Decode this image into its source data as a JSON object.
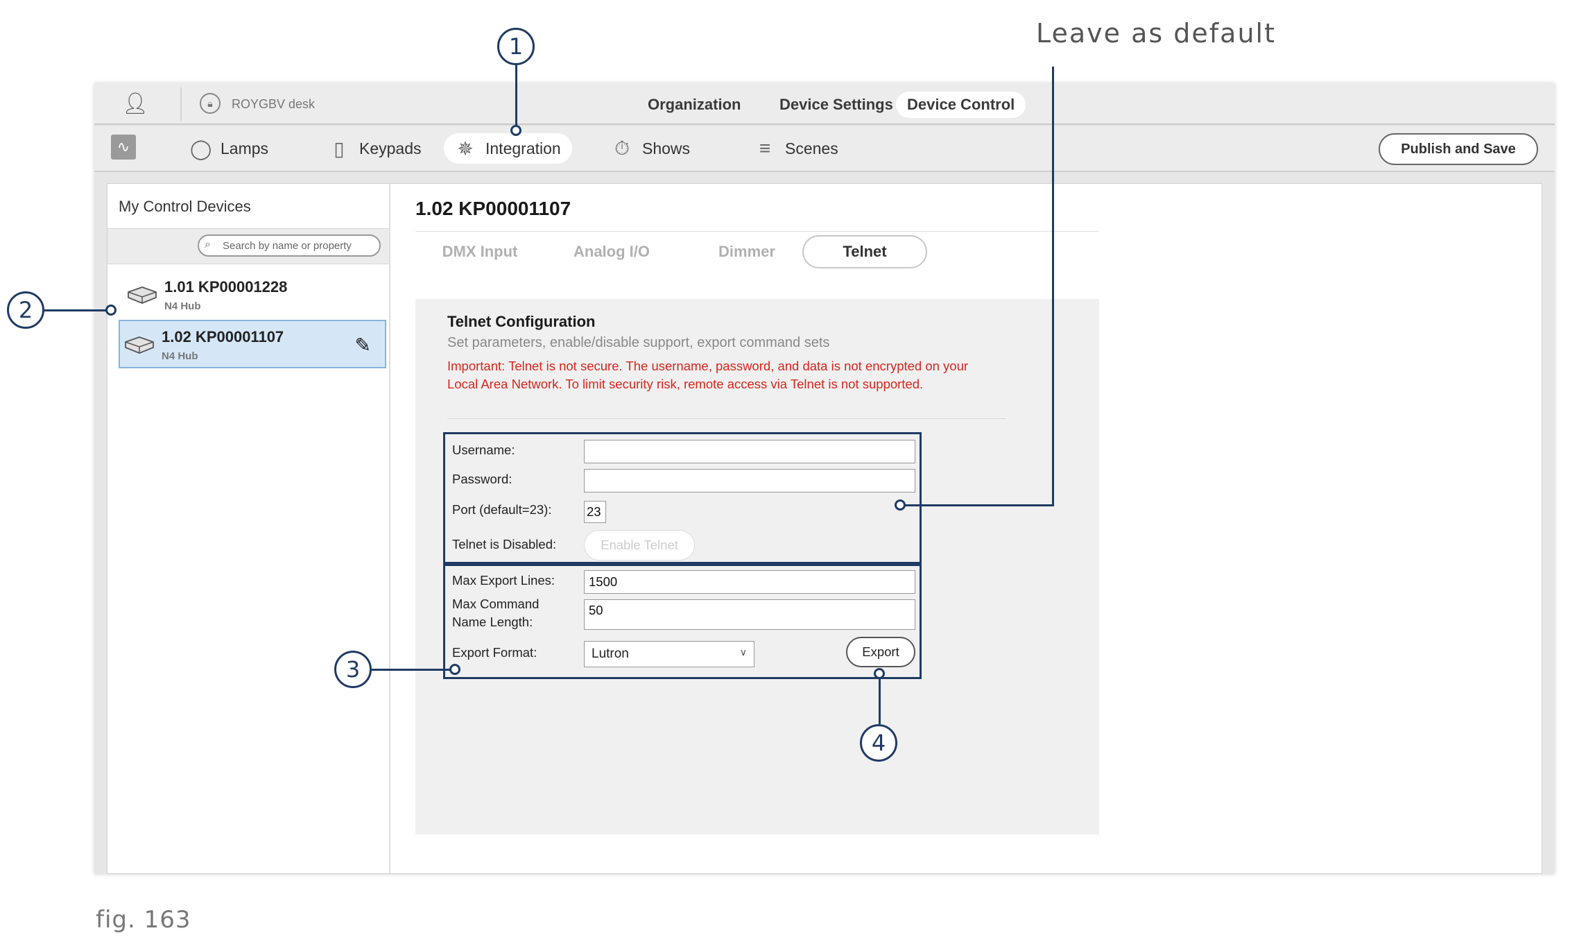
{
  "annotations": {
    "top_note": "Leave as default",
    "callouts": [
      "1",
      "2",
      "3",
      "4"
    ],
    "caption": "fig. 163"
  },
  "header": {
    "desk_name": "ROYGBV desk",
    "modes": [
      "Organization",
      "Device Settings",
      "Device Control"
    ],
    "active_mode": "Device Control"
  },
  "toolbar": {
    "items": [
      {
        "label": "Lamps",
        "icon": "lamp-icon"
      },
      {
        "label": "Keypads",
        "icon": "keypad-icon"
      },
      {
        "label": "Integration",
        "icon": "integration-icon"
      },
      {
        "label": "Shows",
        "icon": "stopwatch-icon"
      },
      {
        "label": "Scenes",
        "icon": "sliders-icon"
      }
    ],
    "active_item": "Integration",
    "publish_label": "Publish and Save"
  },
  "left_panel": {
    "title": "My Control Devices",
    "search_placeholder": "Search by name or property",
    "devices": [
      {
        "name": "1.01 KP00001228",
        "type": "N4 Hub",
        "selected": false
      },
      {
        "name": "1.02 KP00001107",
        "type": "N4 Hub",
        "selected": true
      }
    ]
  },
  "main": {
    "device_title": "1.02 KP00001107",
    "tabs": [
      "DMX Input",
      "Analog I/O",
      "Dimmer",
      "Telnet"
    ],
    "active_tab": "Telnet",
    "config": {
      "title": "Telnet Configuration",
      "subtitle": "Set parameters, enable/disable support, export command sets",
      "warning": "Important: Telnet is not secure.  The username, password, and data is not encrypted on your Local Area Network.  To limit security risk, remote access via Telnet is not supported.",
      "username_label": "Username:",
      "username_value": "",
      "password_label": "Password:",
      "password_value": "",
      "port_label": "Port (default=23):",
      "port_value": "23",
      "status_label": "Telnet is Disabled:",
      "enable_button": "Enable Telnet",
      "max_lines_label": "Max Export Lines:",
      "max_lines_value": "1500",
      "max_name_label": "Max Command Name Length:",
      "max_name_value": "50",
      "format_label": "Export Format:",
      "format_value": "Lutron",
      "export_button": "Export"
    }
  },
  "colors": {
    "annotation": "#1f3b63",
    "warning": "#d9251c",
    "selected_bg": "#d5e7f7"
  }
}
